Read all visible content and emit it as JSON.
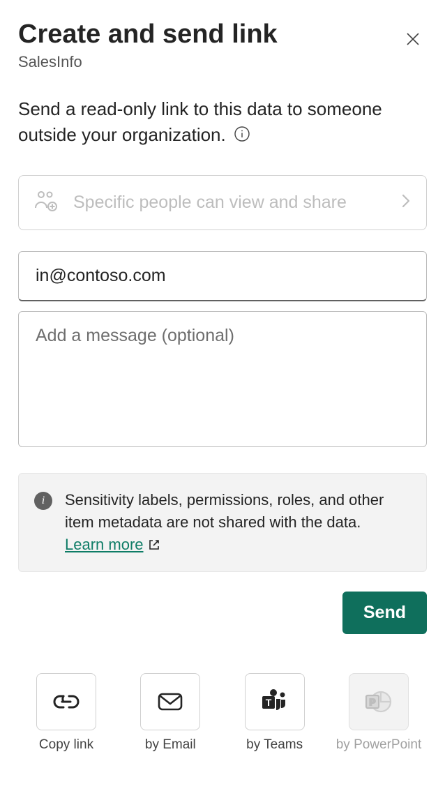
{
  "header": {
    "title": "Create and send link",
    "subtitle": "SalesInfo"
  },
  "description": "Send a read-only link to this data to someone outside your organization.",
  "link_settings": {
    "label": "Specific people can view and share"
  },
  "email_input": {
    "value": "in@contoso.com"
  },
  "message_input": {
    "placeholder": "Add a message (optional)"
  },
  "info_box": {
    "text": "Sensitivity labels, permissions, roles, and other item metadata are not shared with the data.",
    "learn_more_label": "Learn more"
  },
  "send_button": "Send",
  "share_options": {
    "copy_link": "Copy link",
    "by_email": "by Email",
    "by_teams": "by Teams",
    "by_powerpoint": "by PowerPoint"
  }
}
